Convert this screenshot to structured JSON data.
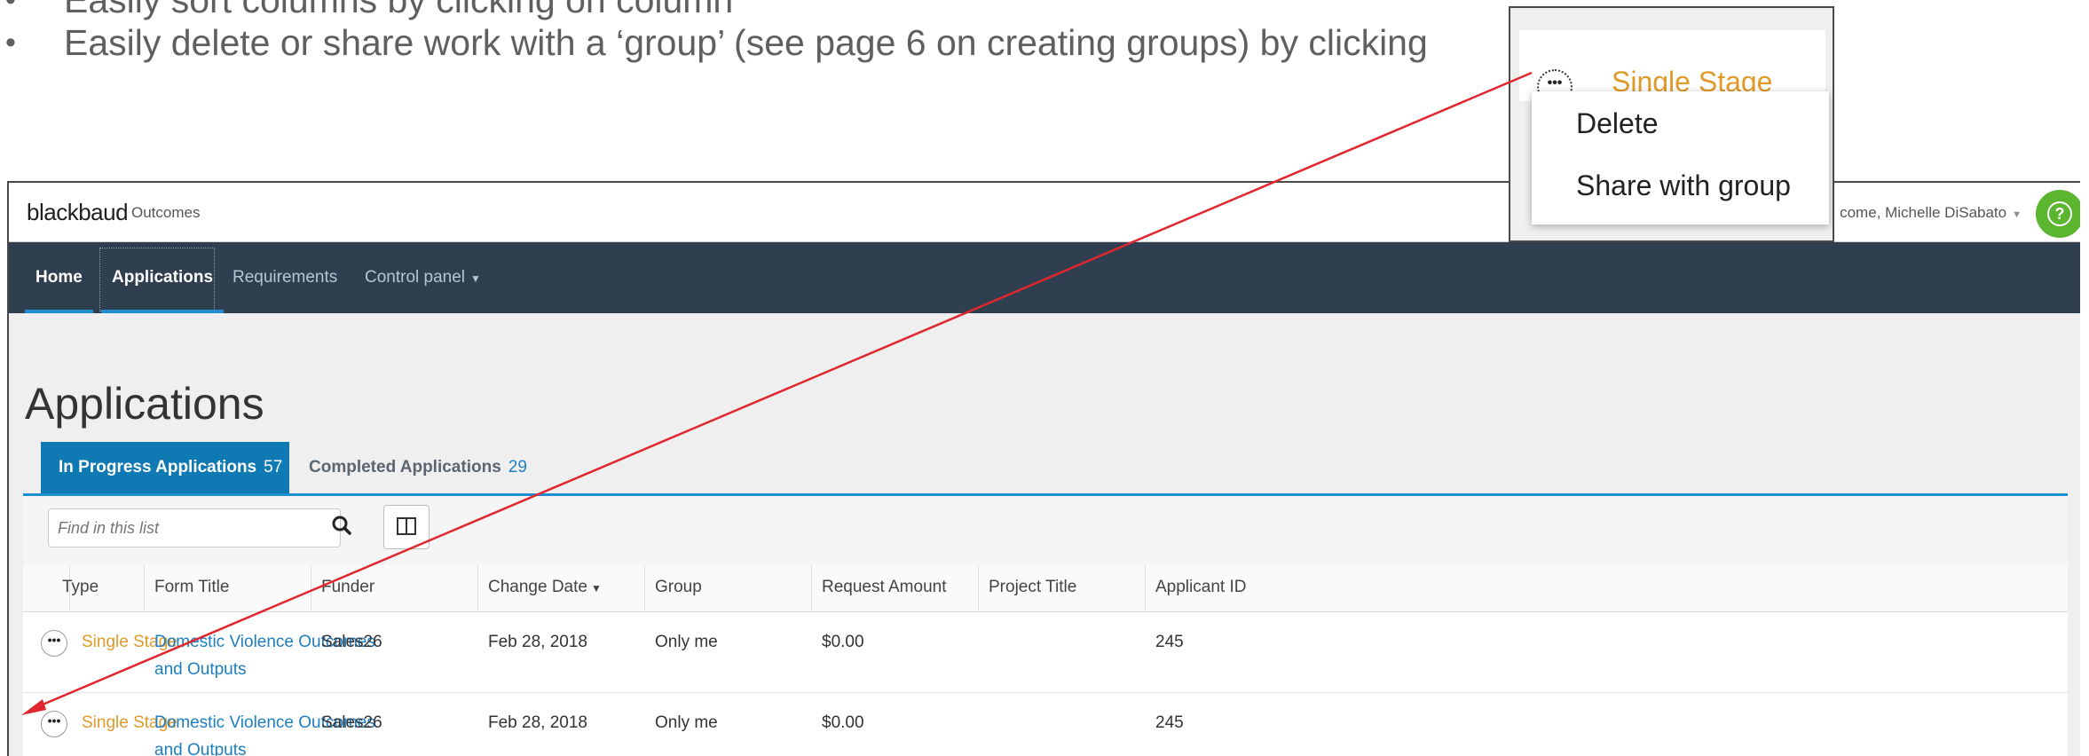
{
  "slide": {
    "bullets": [
      {
        "marker": "•",
        "text": "Easily sort columns by clicking on column"
      },
      {
        "marker": "•",
        "text": "Easily delete or share work with a ‘group’ (see page 6 on creating groups) by clicking"
      }
    ]
  },
  "app": {
    "logo": "blackbaud",
    "product": "Outcomes",
    "welcome": "come, Michelle DiSabato",
    "nav": [
      {
        "label": "Home"
      },
      {
        "label": "Applications"
      },
      {
        "label": "Requirements"
      },
      {
        "label": "Control panel"
      }
    ],
    "page_title": "Applications",
    "tabs": [
      {
        "label": "In Progress Applications",
        "count": "57"
      },
      {
        "label": "Completed Applications",
        "count": "29"
      }
    ],
    "search": {
      "placeholder": "Find in this list"
    },
    "columns": [
      "Type",
      "Form Title",
      "Funder",
      "Change Date",
      "Group",
      "Request Amount",
      "Project Title",
      "Applicant ID"
    ],
    "rows": [
      {
        "type": "Single Stage",
        "form_title": "Domestic Violence Outcomes and Outputs",
        "funder": "Sales26",
        "change_date": "Feb 28, 2018",
        "group": "Only me",
        "request_amount": "$0.00",
        "project_title": "",
        "applicant_id": "245"
      },
      {
        "type": "Single Stage",
        "form_title": "Domestic Violence Outcomes and Outputs",
        "funder": "Sales26",
        "change_date": "Feb 28, 2018",
        "group": "Only me",
        "request_amount": "$0.00",
        "project_title": "",
        "applicant_id": "245"
      }
    ]
  },
  "callout": {
    "type": "Single Stage",
    "menu": [
      "Delete",
      "Share with group"
    ]
  },
  "colors": {
    "nav_bg": "#2f3f4f",
    "accent_blue": "#0f79b3",
    "link_blue": "#1d7fc2",
    "type_orange": "#e09a2a",
    "help_green": "#5cb52f",
    "arrow_red": "#e0262e"
  },
  "icons": {
    "search": "search-icon",
    "columns": "columns-icon",
    "context_menu": "ellipsis-icon",
    "help": "help-icon",
    "dropdown": "caret-down-icon"
  }
}
